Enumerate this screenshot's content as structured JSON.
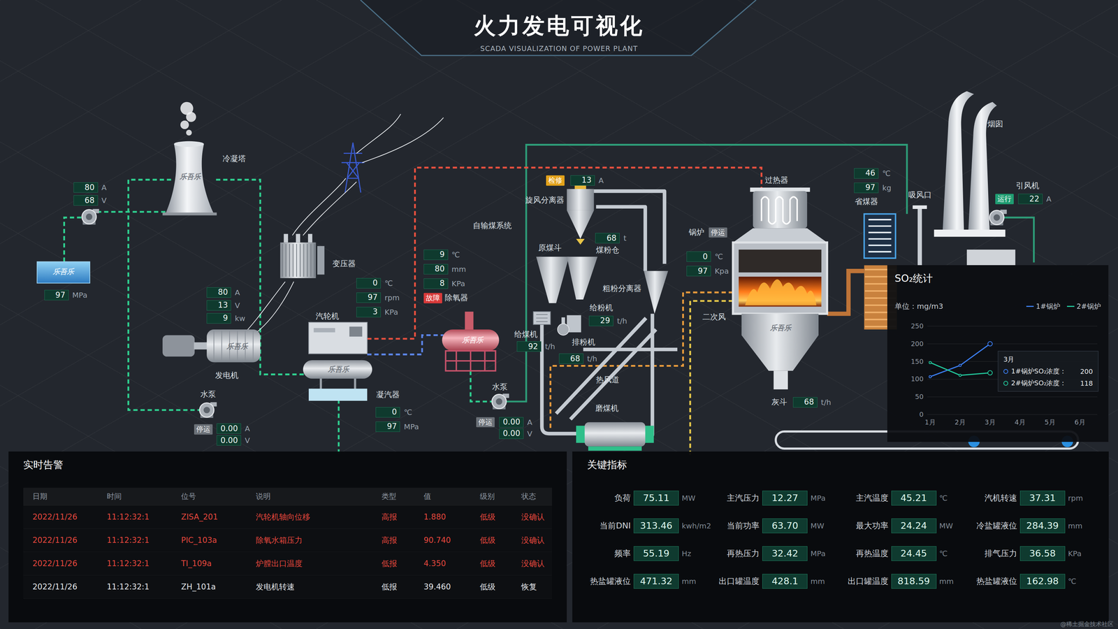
{
  "header": {
    "title": "火力发电可视化",
    "subtitle": "SCADA VISUALIZATION OF POWER PLANT"
  },
  "diagram": {
    "watermark": "乐吾乐",
    "labels": {
      "coolingTower": "冷凝塔",
      "transformer": "变压器",
      "generator": "发电机",
      "pumpLeft": "水泵",
      "turbine": "汽轮机",
      "deaerator": "除氧器",
      "condenser": "凝汽器",
      "coalSystem": "自输煤系统",
      "pumpMid": "水泵",
      "cyclone": "旋风分离器",
      "coalBin": "煤粉仓",
      "rawHopper": "原煤斗",
      "coarseSeparator": "粗粉分离器",
      "powderFeeder": "给粉机",
      "coalFeeder": "给煤机",
      "exhauster": "排粉机",
      "hotAirDuct": "热风道",
      "mill": "磨煤机",
      "boiler": "锅炉",
      "secondaryAir": "二次风",
      "superheater": "过热器",
      "ashHopper": "灰斗",
      "economizer": "省煤器",
      "airInlet": "吸风口",
      "inducedFan": "引风机",
      "chimney": "烟囱"
    },
    "readings": {
      "leftPump": [
        {
          "value": "80",
          "unit": "A"
        },
        {
          "value": "68",
          "unit": "V"
        }
      ],
      "tank": [
        {
          "value": "97",
          "unit": "MPa"
        }
      ],
      "generator": [
        {
          "value": "80",
          "unit": "A"
        },
        {
          "value": "13",
          "unit": "V"
        },
        {
          "value": "9",
          "unit": "kw"
        }
      ],
      "pumpLeft": [
        {
          "value": "0.00",
          "unit": "A"
        },
        {
          "value": "0.00",
          "unit": "V"
        }
      ],
      "turbine": [
        {
          "value": "0",
          "unit": "℃"
        },
        {
          "value": "97",
          "unit": "rpm"
        },
        {
          "value": "3",
          "unit": "KPa"
        }
      ],
      "deaerator": [
        {
          "value": "9",
          "unit": "℃"
        },
        {
          "value": "80",
          "unit": "mm"
        },
        {
          "value": "8",
          "unit": "KPa"
        }
      ],
      "condenser": [
        {
          "value": "0",
          "unit": "℃"
        },
        {
          "value": "97",
          "unit": "MPa"
        }
      ],
      "pumpMid": [
        {
          "value": "0.00",
          "unit": "A"
        },
        {
          "value": "0.00",
          "unit": "V"
        }
      ],
      "cyclone": [
        {
          "value": "13",
          "unit": "A"
        }
      ],
      "coalBin": [
        {
          "value": "68",
          "unit": "t"
        }
      ],
      "powderFeeder": [
        {
          "value": "29",
          "unit": "t/h"
        }
      ],
      "coalFeeder": [
        {
          "value": "92",
          "unit": "t/h"
        }
      ],
      "exhauster": [
        {
          "value": "68",
          "unit": "t/h"
        }
      ],
      "boiler": [
        {
          "value": "0",
          "unit": "℃"
        },
        {
          "value": "97",
          "unit": "Kpa"
        }
      ],
      "ashHopper": [
        {
          "value": "68",
          "unit": "t/h"
        }
      ],
      "economizer": [
        {
          "value": "46",
          "unit": "℃"
        },
        {
          "value": "97",
          "unit": "kg"
        }
      ],
      "inducedFan": [
        {
          "value": "22",
          "unit": "A"
        }
      ]
    },
    "badges": {
      "pumpLeft": {
        "text": "停运",
        "color": "#6b7178"
      },
      "deaerator": {
        "text": "故障",
        "color": "#d93a3a"
      },
      "pumpMid": {
        "text": "停运",
        "color": "#6b7178"
      },
      "cyclone": {
        "text": "检修",
        "color": "#e3a21a"
      },
      "boiler": {
        "text": "停运",
        "color": "#6b7178"
      },
      "inducedFan": {
        "text": "运行",
        "color": "#1f9d72"
      }
    }
  },
  "so2": {
    "title": "SO₂统计",
    "unit": "单位：mg/m3",
    "yTicks": [
      "0",
      "50",
      "100",
      "150",
      "200",
      "250"
    ],
    "xLabels": [
      "1月",
      "2月",
      "3月",
      "4月",
      "5月",
      "6月"
    ],
    "series": [
      {
        "name": "1#锅炉",
        "color": "#3b7df0",
        "values": [
          107,
          139,
          200
        ]
      },
      {
        "name": "2#锅炉",
        "color": "#22c59a",
        "values": [
          147,
          111,
          118
        ]
      }
    ],
    "tooltip": {
      "title": "3月",
      "rows": [
        {
          "label": "1#锅炉SO₂浓度：",
          "value": "200"
        },
        {
          "label": "2#锅炉SO₂浓度：",
          "value": "118"
        }
      ]
    }
  },
  "alerts": {
    "title": "实时告警",
    "columns": [
      "日期",
      "时间",
      "位号",
      "说明",
      "类型",
      "值",
      "级别",
      "状态"
    ],
    "rows": [
      {
        "cells": [
          "2022/11/26",
          "11:12:32:1",
          "ZISA_201",
          "汽轮机轴向位移",
          "高报",
          "1.880",
          "低级",
          "没确认"
        ],
        "color": "#e5473d"
      },
      {
        "cells": [
          "2022/11/26",
          "11:12:32:1",
          "PIC_103a",
          "除氧水箱压力",
          "高报",
          "90.740",
          "低级",
          "没确认"
        ],
        "color": "#e5473d"
      },
      {
        "cells": [
          "2022/11/26",
          "11:12:32:1",
          "TI_109a",
          "炉膛出口温度",
          "低报",
          "4.350",
          "低级",
          "没确认"
        ],
        "color": "#e5473d"
      },
      {
        "cells": [
          "2022/11/26",
          "11:12:32:1",
          "ZH_101a",
          "发电机转速",
          "低报",
          "39.460",
          "低级",
          "恢复"
        ],
        "color": "#e3e6ea"
      }
    ]
  },
  "indicators": {
    "title": "关键指标",
    "items": [
      {
        "label": "负荷",
        "value": "75.11",
        "unit": "MW"
      },
      {
        "label": "主汽压力",
        "value": "12.27",
        "unit": "MPa"
      },
      {
        "label": "主汽温度",
        "value": "45.21",
        "unit": "℃"
      },
      {
        "label": "汽机转速",
        "value": "37.31",
        "unit": "rpm"
      },
      {
        "label": "当前DNI",
        "value": "313.46",
        "unit": "kwh/m2"
      },
      {
        "label": "当前功率",
        "value": "63.70",
        "unit": "MW"
      },
      {
        "label": "最大功率",
        "value": "24.24",
        "unit": "MW"
      },
      {
        "label": "冷盐罐液位",
        "value": "284.39",
        "unit": "mm"
      },
      {
        "label": "频率",
        "value": "55.19",
        "unit": "Hz"
      },
      {
        "label": "再热压力",
        "value": "32.42",
        "unit": "MPa"
      },
      {
        "label": "再热温度",
        "value": "24.45",
        "unit": "℃"
      },
      {
        "label": "排气压力",
        "value": "36.58",
        "unit": "KPa"
      },
      {
        "label": "热盐罐液位",
        "value": "471.32",
        "unit": "mm"
      },
      {
        "label": "出口罐温度",
        "value": "428.1",
        "unit": "mm"
      },
      {
        "label": "出口罐温度",
        "value": "818.59",
        "unit": "mm"
      },
      {
        "label": "热盐罐液位",
        "value": "162.98",
        "unit": "℃"
      }
    ]
  },
  "footer": "@稀土掘金技术社区"
}
